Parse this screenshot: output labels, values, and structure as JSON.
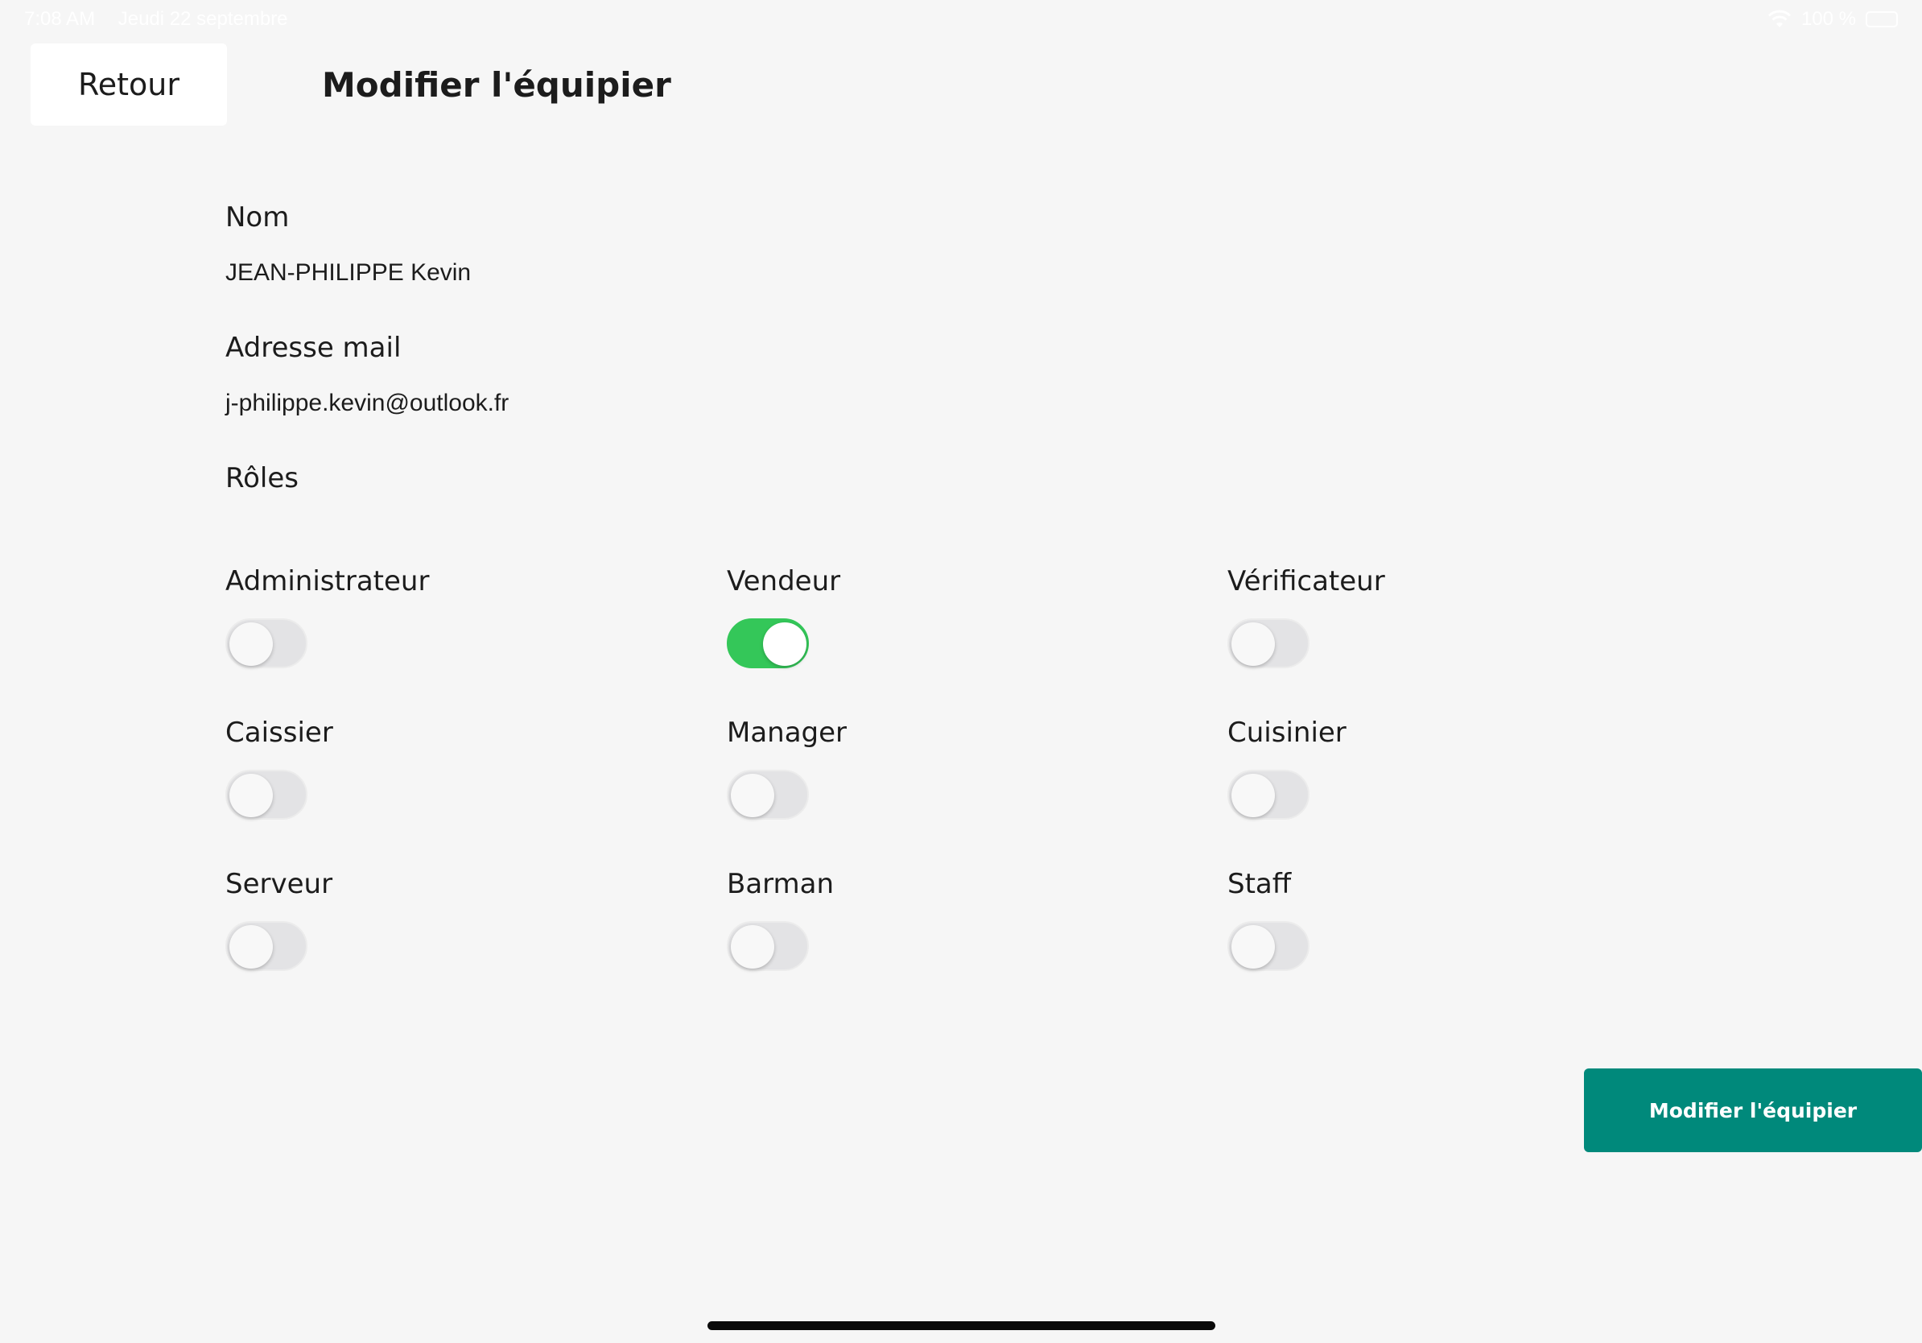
{
  "status_bar": {
    "time": "7:08 AM",
    "date": "Jeudi 22 septembre",
    "battery": "100 %"
  },
  "header": {
    "back_label": "Retour",
    "title": "Modifier l'équipier"
  },
  "form": {
    "name_label": "Nom",
    "name_value": "JEAN-PHILIPPE Kevin",
    "email_label": "Adresse mail",
    "email_value": "j-philippe.kevin@outlook.fr",
    "roles_label": "Rôles"
  },
  "roles": [
    {
      "label": "Administrateur",
      "enabled": false
    },
    {
      "label": "Vendeur",
      "enabled": true
    },
    {
      "label": "Vérificateur",
      "enabled": false
    },
    {
      "label": "Caissier",
      "enabled": false
    },
    {
      "label": "Manager",
      "enabled": false
    },
    {
      "label": "Cuisinier",
      "enabled": false
    },
    {
      "label": "Serveur",
      "enabled": false
    },
    {
      "label": "Barman",
      "enabled": false
    },
    {
      "label": "Staff",
      "enabled": false
    }
  ],
  "submit_label": "Modifier l'équipier",
  "colors": {
    "accent": "#00897b",
    "toggle_on": "#34c759",
    "toggle_off": "#e3e3e5",
    "background": "#f6f6f6"
  }
}
